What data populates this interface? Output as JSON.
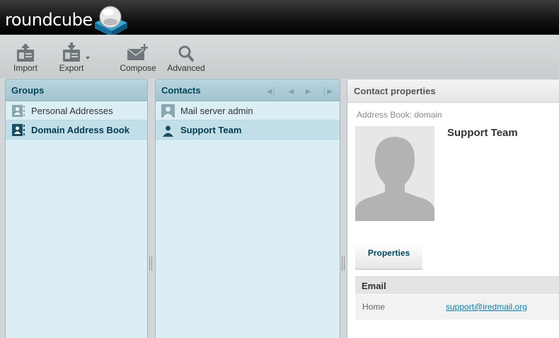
{
  "app": {
    "logo_text": "roundcube"
  },
  "toolbar": {
    "import_label": "Import",
    "export_label": "Export",
    "compose_label": "Compose",
    "advanced_label": "Advanced"
  },
  "groups": {
    "title": "Groups",
    "items": [
      {
        "label": "Personal Addresses",
        "selected": false
      },
      {
        "label": "Domain Address Book",
        "selected": true
      }
    ]
  },
  "contacts": {
    "title": "Contacts",
    "items": [
      {
        "label": "Mail server admin",
        "selected": false
      },
      {
        "label": "Support Team",
        "selected": true
      }
    ]
  },
  "contact_properties": {
    "title": "Contact properties",
    "address_book": "Address Book: domain",
    "name": "Support Team",
    "tab_label": "Properties",
    "section_email": "Email",
    "email_type": "Home",
    "email_value": "support@iredmail.org"
  },
  "icons": {
    "import": "import-icon",
    "export": "export-icon",
    "compose": "compose-icon",
    "advanced": "magnifier-icon",
    "group": "address-book-icon",
    "contact": "person-icon"
  },
  "colors": {
    "header_bg": "#000000",
    "panel_bg": "#daeef4",
    "panel_head": "#a3c4d1",
    "accent": "#004458",
    "link": "#0a7fa3"
  }
}
